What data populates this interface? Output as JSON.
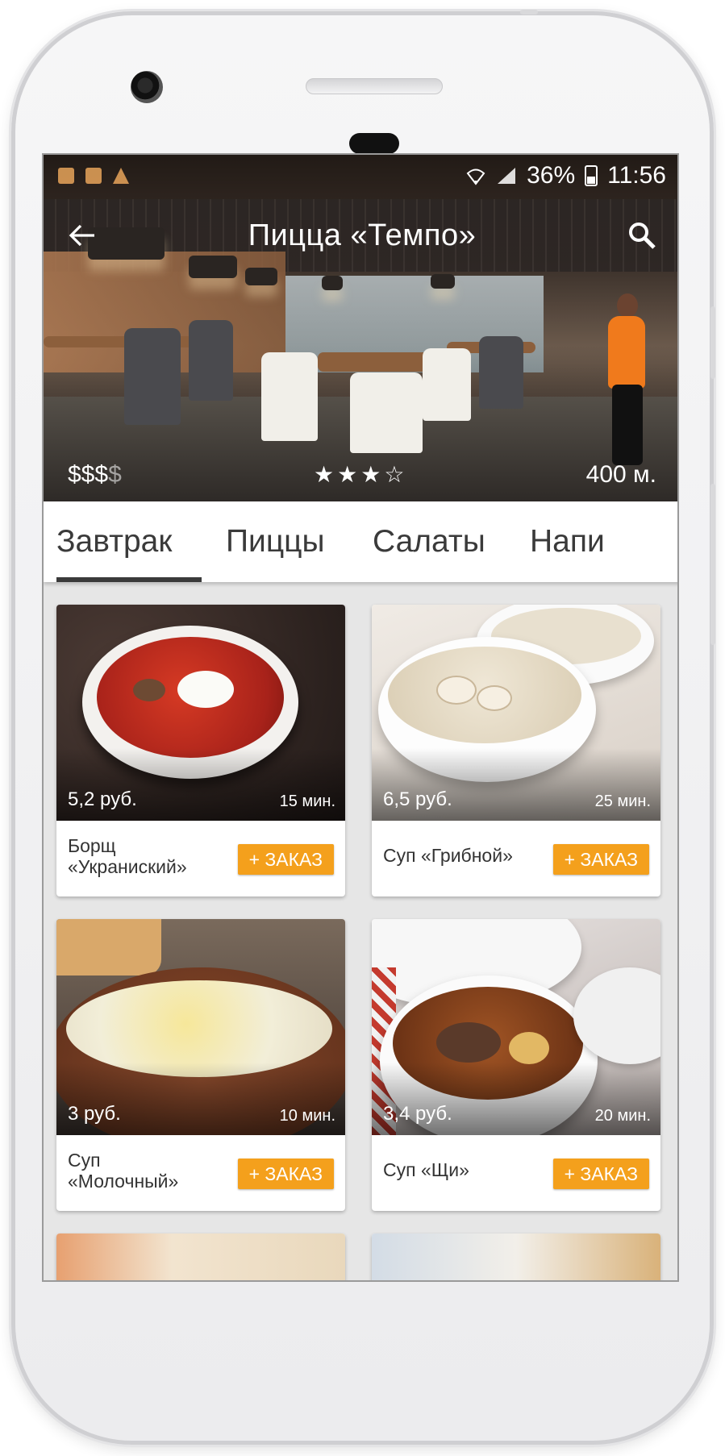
{
  "status_bar": {
    "battery": "36%",
    "time": "11:56"
  },
  "toolbar": {
    "title": "Пицца «Темпо»"
  },
  "hero": {
    "price_level": "$$$",
    "price_level_inactive": "$",
    "rating_filled": "★★★",
    "rating_empty": "☆",
    "rating": 3,
    "rating_max": 4,
    "distance": "400 м."
  },
  "tabs": [
    "Завтрак",
    "Пиццы",
    "Салаты",
    "Напи"
  ],
  "order_label": "+ ЗАКАЗ",
  "dishes": [
    {
      "name": "Борщ «Украниский»",
      "name_line1": "Борщ",
      "name_line2": "«Украниский»",
      "price": "5,2 руб.",
      "time": "15 мин."
    },
    {
      "name": "Суп «Грибной»",
      "price": "6,5 руб.",
      "time": "25 мин."
    },
    {
      "name": "Суп «Молочный»",
      "name_line1": "Суп",
      "name_line2": "«Молочный»",
      "price": "3 руб.",
      "time": "10 мин."
    },
    {
      "name": "Суп «Щи»",
      "price": "3,4 руб.",
      "time": "20 мин."
    }
  ],
  "colors": {
    "accent": "#f4a01c",
    "tab_text": "#3a3a3a",
    "background": "#e6e6e6"
  }
}
